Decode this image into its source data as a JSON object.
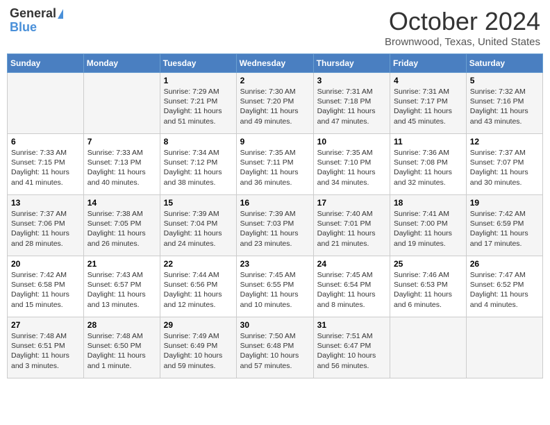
{
  "header": {
    "logo_general": "General",
    "logo_blue": "Blue",
    "month_title": "October 2024",
    "location": "Brownwood, Texas, United States"
  },
  "days_of_week": [
    "Sunday",
    "Monday",
    "Tuesday",
    "Wednesday",
    "Thursday",
    "Friday",
    "Saturday"
  ],
  "weeks": [
    [
      {
        "num": "",
        "sunrise": "",
        "sunset": "",
        "daylight": ""
      },
      {
        "num": "",
        "sunrise": "",
        "sunset": "",
        "daylight": ""
      },
      {
        "num": "1",
        "sunrise": "Sunrise: 7:29 AM",
        "sunset": "Sunset: 7:21 PM",
        "daylight": "Daylight: 11 hours and 51 minutes."
      },
      {
        "num": "2",
        "sunrise": "Sunrise: 7:30 AM",
        "sunset": "Sunset: 7:20 PM",
        "daylight": "Daylight: 11 hours and 49 minutes."
      },
      {
        "num": "3",
        "sunrise": "Sunrise: 7:31 AM",
        "sunset": "Sunset: 7:18 PM",
        "daylight": "Daylight: 11 hours and 47 minutes."
      },
      {
        "num": "4",
        "sunrise": "Sunrise: 7:31 AM",
        "sunset": "Sunset: 7:17 PM",
        "daylight": "Daylight: 11 hours and 45 minutes."
      },
      {
        "num": "5",
        "sunrise": "Sunrise: 7:32 AM",
        "sunset": "Sunset: 7:16 PM",
        "daylight": "Daylight: 11 hours and 43 minutes."
      }
    ],
    [
      {
        "num": "6",
        "sunrise": "Sunrise: 7:33 AM",
        "sunset": "Sunset: 7:15 PM",
        "daylight": "Daylight: 11 hours and 41 minutes."
      },
      {
        "num": "7",
        "sunrise": "Sunrise: 7:33 AM",
        "sunset": "Sunset: 7:13 PM",
        "daylight": "Daylight: 11 hours and 40 minutes."
      },
      {
        "num": "8",
        "sunrise": "Sunrise: 7:34 AM",
        "sunset": "Sunset: 7:12 PM",
        "daylight": "Daylight: 11 hours and 38 minutes."
      },
      {
        "num": "9",
        "sunrise": "Sunrise: 7:35 AM",
        "sunset": "Sunset: 7:11 PM",
        "daylight": "Daylight: 11 hours and 36 minutes."
      },
      {
        "num": "10",
        "sunrise": "Sunrise: 7:35 AM",
        "sunset": "Sunset: 7:10 PM",
        "daylight": "Daylight: 11 hours and 34 minutes."
      },
      {
        "num": "11",
        "sunrise": "Sunrise: 7:36 AM",
        "sunset": "Sunset: 7:08 PM",
        "daylight": "Daylight: 11 hours and 32 minutes."
      },
      {
        "num": "12",
        "sunrise": "Sunrise: 7:37 AM",
        "sunset": "Sunset: 7:07 PM",
        "daylight": "Daylight: 11 hours and 30 minutes."
      }
    ],
    [
      {
        "num": "13",
        "sunrise": "Sunrise: 7:37 AM",
        "sunset": "Sunset: 7:06 PM",
        "daylight": "Daylight: 11 hours and 28 minutes."
      },
      {
        "num": "14",
        "sunrise": "Sunrise: 7:38 AM",
        "sunset": "Sunset: 7:05 PM",
        "daylight": "Daylight: 11 hours and 26 minutes."
      },
      {
        "num": "15",
        "sunrise": "Sunrise: 7:39 AM",
        "sunset": "Sunset: 7:04 PM",
        "daylight": "Daylight: 11 hours and 24 minutes."
      },
      {
        "num": "16",
        "sunrise": "Sunrise: 7:39 AM",
        "sunset": "Sunset: 7:03 PM",
        "daylight": "Daylight: 11 hours and 23 minutes."
      },
      {
        "num": "17",
        "sunrise": "Sunrise: 7:40 AM",
        "sunset": "Sunset: 7:01 PM",
        "daylight": "Daylight: 11 hours and 21 minutes."
      },
      {
        "num": "18",
        "sunrise": "Sunrise: 7:41 AM",
        "sunset": "Sunset: 7:00 PM",
        "daylight": "Daylight: 11 hours and 19 minutes."
      },
      {
        "num": "19",
        "sunrise": "Sunrise: 7:42 AM",
        "sunset": "Sunset: 6:59 PM",
        "daylight": "Daylight: 11 hours and 17 minutes."
      }
    ],
    [
      {
        "num": "20",
        "sunrise": "Sunrise: 7:42 AM",
        "sunset": "Sunset: 6:58 PM",
        "daylight": "Daylight: 11 hours and 15 minutes."
      },
      {
        "num": "21",
        "sunrise": "Sunrise: 7:43 AM",
        "sunset": "Sunset: 6:57 PM",
        "daylight": "Daylight: 11 hours and 13 minutes."
      },
      {
        "num": "22",
        "sunrise": "Sunrise: 7:44 AM",
        "sunset": "Sunset: 6:56 PM",
        "daylight": "Daylight: 11 hours and 12 minutes."
      },
      {
        "num": "23",
        "sunrise": "Sunrise: 7:45 AM",
        "sunset": "Sunset: 6:55 PM",
        "daylight": "Daylight: 11 hours and 10 minutes."
      },
      {
        "num": "24",
        "sunrise": "Sunrise: 7:45 AM",
        "sunset": "Sunset: 6:54 PM",
        "daylight": "Daylight: 11 hours and 8 minutes."
      },
      {
        "num": "25",
        "sunrise": "Sunrise: 7:46 AM",
        "sunset": "Sunset: 6:53 PM",
        "daylight": "Daylight: 11 hours and 6 minutes."
      },
      {
        "num": "26",
        "sunrise": "Sunrise: 7:47 AM",
        "sunset": "Sunset: 6:52 PM",
        "daylight": "Daylight: 11 hours and 4 minutes."
      }
    ],
    [
      {
        "num": "27",
        "sunrise": "Sunrise: 7:48 AM",
        "sunset": "Sunset: 6:51 PM",
        "daylight": "Daylight: 11 hours and 3 minutes."
      },
      {
        "num": "28",
        "sunrise": "Sunrise: 7:48 AM",
        "sunset": "Sunset: 6:50 PM",
        "daylight": "Daylight: 11 hours and 1 minute."
      },
      {
        "num": "29",
        "sunrise": "Sunrise: 7:49 AM",
        "sunset": "Sunset: 6:49 PM",
        "daylight": "Daylight: 10 hours and 59 minutes."
      },
      {
        "num": "30",
        "sunrise": "Sunrise: 7:50 AM",
        "sunset": "Sunset: 6:48 PM",
        "daylight": "Daylight: 10 hours and 57 minutes."
      },
      {
        "num": "31",
        "sunrise": "Sunrise: 7:51 AM",
        "sunset": "Sunset: 6:47 PM",
        "daylight": "Daylight: 10 hours and 56 minutes."
      },
      {
        "num": "",
        "sunrise": "",
        "sunset": "",
        "daylight": ""
      },
      {
        "num": "",
        "sunrise": "",
        "sunset": "",
        "daylight": ""
      }
    ]
  ]
}
